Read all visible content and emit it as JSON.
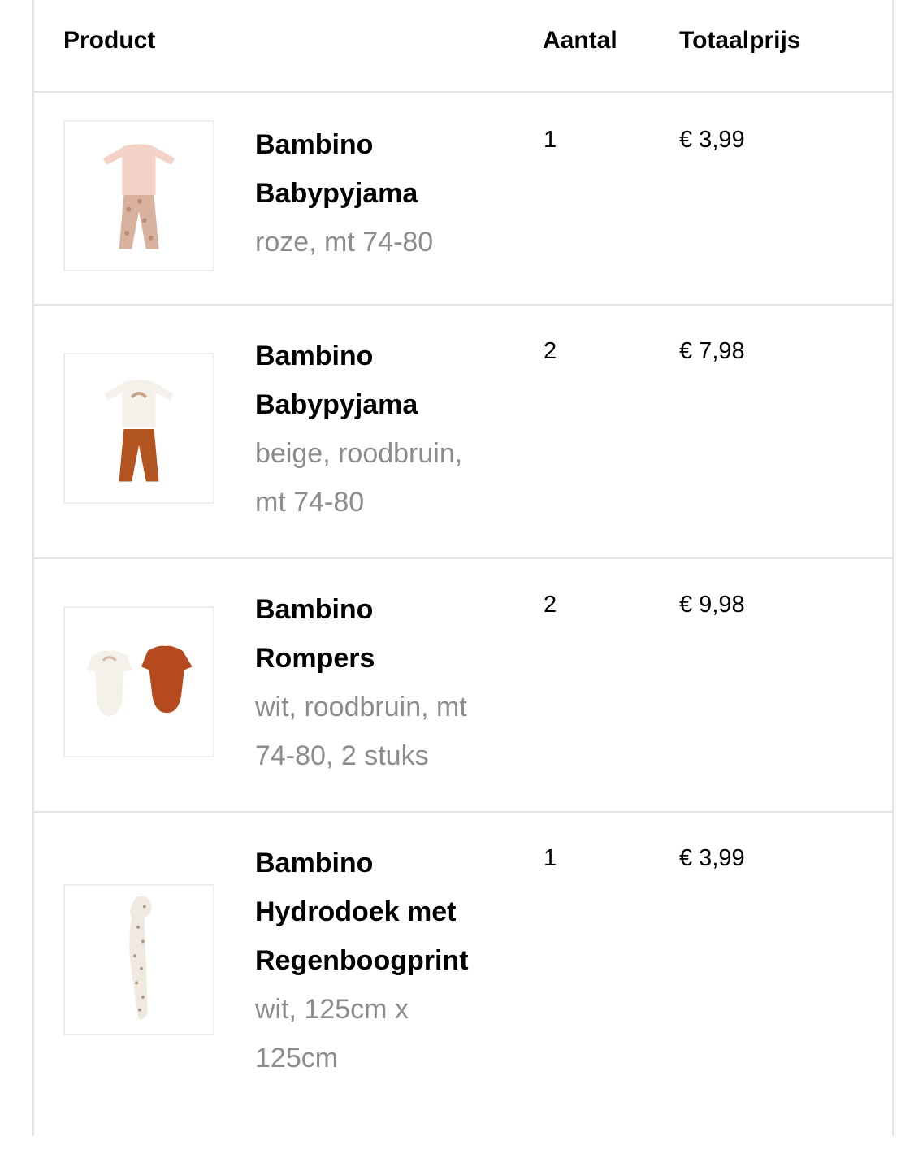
{
  "table": {
    "columns": {
      "product": "Product",
      "quantity": "Aantal",
      "total": "Totaalprijs"
    },
    "items": [
      {
        "name_line1": "Bambino",
        "name_line2": "Babypyjama",
        "name_line3": "",
        "variant_line1": "roze, mt 74-80",
        "variant_line2": "",
        "quantity": "1",
        "price": "€ 3,99",
        "image_icon": "pink-pajama-image"
      },
      {
        "name_line1": "Bambino",
        "name_line2": "Babypyjama",
        "name_line3": "",
        "variant_line1": "beige, roodbruin,",
        "variant_line2": "mt 74-80",
        "quantity": "2",
        "price": "€ 7,98",
        "image_icon": "beige-brown-pajama-image"
      },
      {
        "name_line1": "Bambino",
        "name_line2": "Rompers",
        "name_line3": "",
        "variant_line1": "wit, roodbruin, mt",
        "variant_line2": "74-80, 2 stuks",
        "quantity": "2",
        "price": "€ 9,98",
        "image_icon": "rompers-image"
      },
      {
        "name_line1": "Bambino",
        "name_line2": "Hydrodoek met",
        "name_line3": "Regenboogprint",
        "variant_line1": "wit, 125cm x",
        "variant_line2": "125cm",
        "quantity": "1",
        "price": "€ 3,99",
        "image_icon": "muslin-cloth-image"
      }
    ]
  }
}
